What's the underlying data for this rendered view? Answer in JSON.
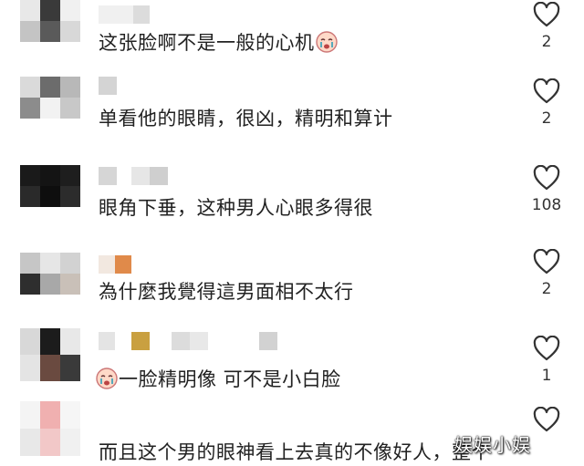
{
  "comments": [
    {
      "text": "这张脸啊不是一般的心机",
      "likes": "2",
      "emoji": "crying-face"
    },
    {
      "text": "单看他的眼睛，很凶，精明和算计",
      "likes": "2"
    },
    {
      "text": "眼角下垂，这种男人心眼多得很",
      "likes": "108"
    },
    {
      "text": "為什麼我覺得這男面相不太行",
      "likes": "2"
    },
    {
      "text": "一脸精明像 可不是小白脸",
      "likes": "1",
      "emoji": "crying-face"
    },
    {
      "text": "而且这个男的眼神看上去真的不像好人，整个",
      "likes": ""
    }
  ],
  "watermark": "娱娱小娱",
  "colors": {
    "heart": "#333333",
    "text": "#222222",
    "count": "#333333"
  }
}
